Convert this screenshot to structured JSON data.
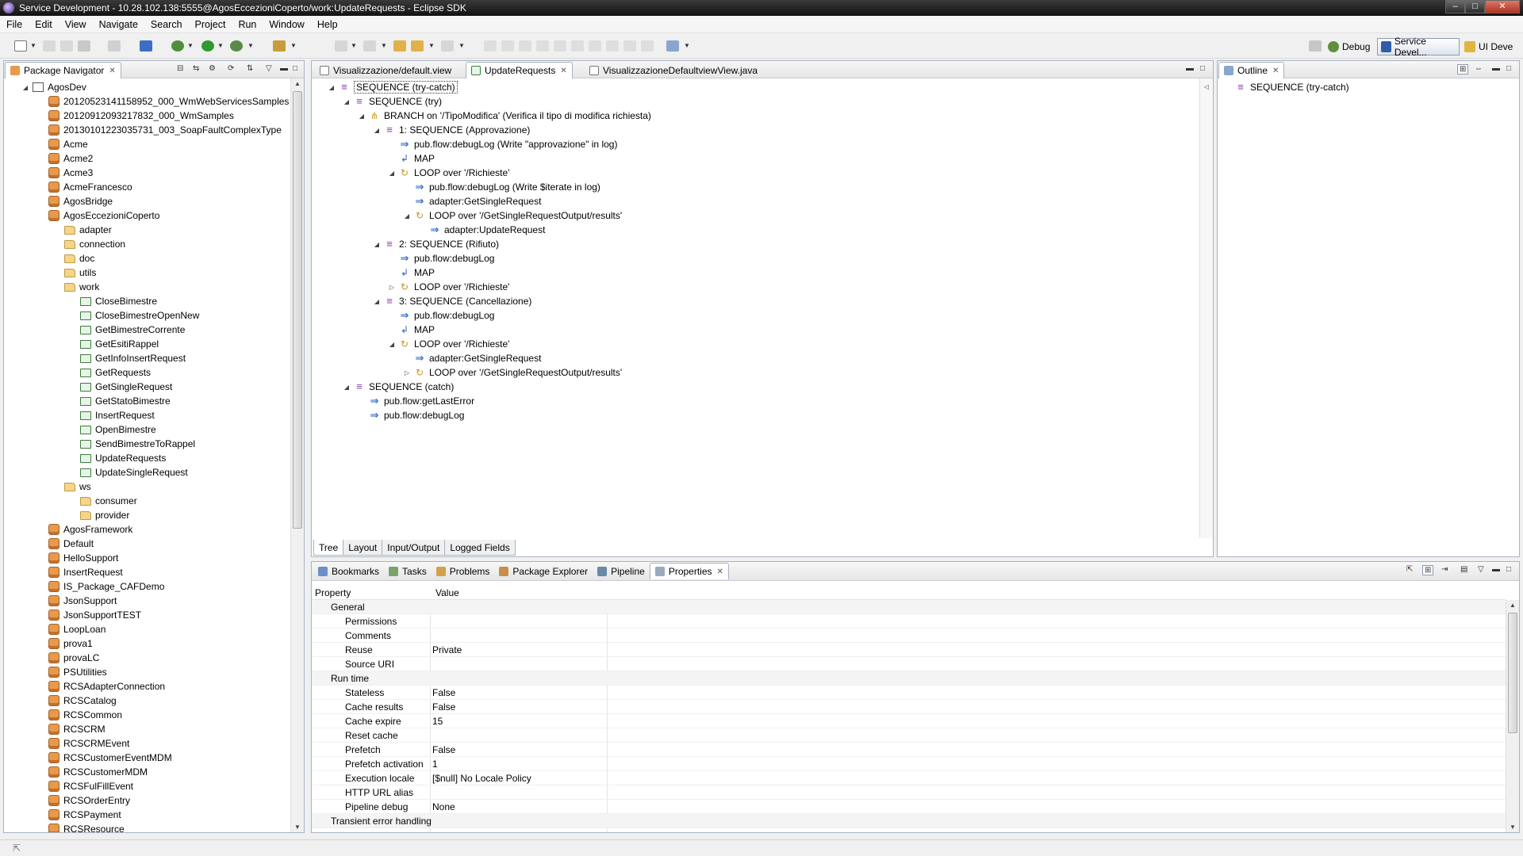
{
  "window": {
    "title": "Service Development - 10.28.102.138:5555@AgosEccezioniCoperto/work:UpdateRequests - Eclipse SDK",
    "controls": [
      "–",
      "□",
      "✕"
    ]
  },
  "menu": [
    "File",
    "Edit",
    "View",
    "Navigate",
    "Search",
    "Project",
    "Run",
    "Window",
    "Help"
  ],
  "perspectives": [
    {
      "label": "Debug",
      "active": false
    },
    {
      "label": "Service Devel...",
      "active": true
    },
    {
      "label": "UI Deve",
      "active": false
    }
  ],
  "navigator": {
    "tab": "Package Navigator",
    "items": [
      {
        "label": "AgosDev",
        "level": 0,
        "icon": "root",
        "twisty": "◢"
      },
      {
        "label": "20120523141158952_000_WmWebServicesSamples",
        "level": 1,
        "icon": "pkg"
      },
      {
        "label": "20120912093217832_000_WmSamples",
        "level": 1,
        "icon": "pkg"
      },
      {
        "label": "20130101223035731_003_SoapFaultComplexType",
        "level": 1,
        "icon": "pkg"
      },
      {
        "label": "Acme",
        "level": 1,
        "icon": "pkg"
      },
      {
        "label": "Acme2",
        "level": 1,
        "icon": "pkg"
      },
      {
        "label": "Acme3",
        "level": 1,
        "icon": "pkg"
      },
      {
        "label": "AcmeFrancesco",
        "level": 1,
        "icon": "pkg"
      },
      {
        "label": "AgosBridge",
        "level": 1,
        "icon": "pkg"
      },
      {
        "label": "AgosEccezioniCoperto",
        "level": 1,
        "icon": "pkg"
      },
      {
        "label": "adapter",
        "level": 2,
        "icon": "folder"
      },
      {
        "label": "connection",
        "level": 2,
        "icon": "folder"
      },
      {
        "label": "doc",
        "level": 2,
        "icon": "folder"
      },
      {
        "label": "utils",
        "level": 2,
        "icon": "folder"
      },
      {
        "label": "work",
        "level": 2,
        "icon": "folder"
      },
      {
        "label": "CloseBimestre",
        "level": 3,
        "icon": "svc"
      },
      {
        "label": "CloseBimestreOpenNew",
        "level": 3,
        "icon": "svc"
      },
      {
        "label": "GetBimestreCorrente",
        "level": 3,
        "icon": "svc"
      },
      {
        "label": "GetEsitiRappel",
        "level": 3,
        "icon": "svc"
      },
      {
        "label": "GetInfoInsertRequest",
        "level": 3,
        "icon": "svc"
      },
      {
        "label": "GetRequests",
        "level": 3,
        "icon": "svc"
      },
      {
        "label": "GetSingleRequest",
        "level": 3,
        "icon": "svc"
      },
      {
        "label": "GetStatoBimestre",
        "level": 3,
        "icon": "svc"
      },
      {
        "label": "InsertRequest",
        "level": 3,
        "icon": "svc"
      },
      {
        "label": "OpenBimestre",
        "level": 3,
        "icon": "svc"
      },
      {
        "label": "SendBimestreToRappel",
        "level": 3,
        "icon": "svc"
      },
      {
        "label": "UpdateRequests",
        "level": 3,
        "icon": "svc"
      },
      {
        "label": "UpdateSingleRequest",
        "level": 3,
        "icon": "svc"
      },
      {
        "label": "ws",
        "level": 2,
        "icon": "folder"
      },
      {
        "label": "consumer",
        "level": 3,
        "icon": "folder"
      },
      {
        "label": "provider",
        "level": 3,
        "icon": "folder"
      },
      {
        "label": "AgosFramework",
        "level": 1,
        "icon": "pkg"
      },
      {
        "label": "Default",
        "level": 1,
        "icon": "pkg"
      },
      {
        "label": "HelloSupport",
        "level": 1,
        "icon": "pkg"
      },
      {
        "label": "InsertRequest",
        "level": 1,
        "icon": "pkg"
      },
      {
        "label": "IS_Package_CAFDemo",
        "level": 1,
        "icon": "pkg"
      },
      {
        "label": "JsonSupport",
        "level": 1,
        "icon": "pkg"
      },
      {
        "label": "JsonSupportTEST",
        "level": 1,
        "icon": "pkg"
      },
      {
        "label": "LoopLoan",
        "level": 1,
        "icon": "pkg"
      },
      {
        "label": "prova1",
        "level": 1,
        "icon": "pkg"
      },
      {
        "label": "provaLC",
        "level": 1,
        "icon": "pkg"
      },
      {
        "label": "PSUtilities",
        "level": 1,
        "icon": "pkg"
      },
      {
        "label": "RCSAdapterConnection",
        "level": 1,
        "icon": "pkg"
      },
      {
        "label": "RCSCatalog",
        "level": 1,
        "icon": "pkg"
      },
      {
        "label": "RCSCommon",
        "level": 1,
        "icon": "pkg"
      },
      {
        "label": "RCSCRM",
        "level": 1,
        "icon": "pkg"
      },
      {
        "label": "RCSCRMEvent",
        "level": 1,
        "icon": "pkg"
      },
      {
        "label": "RCSCustomerEventMDM",
        "level": 1,
        "icon": "pkg"
      },
      {
        "label": "RCSCustomerMDM",
        "level": 1,
        "icon": "pkg"
      },
      {
        "label": "RCSFulFillEvent",
        "level": 1,
        "icon": "pkg"
      },
      {
        "label": "RCSOrderEntry",
        "level": 1,
        "icon": "pkg"
      },
      {
        "label": "RCSPayment",
        "level": 1,
        "icon": "pkg"
      },
      {
        "label": "RCSResource",
        "level": 1,
        "icon": "pkg"
      }
    ]
  },
  "editor": {
    "tabs": [
      {
        "label": "Visualizzazione/default.view",
        "active": false
      },
      {
        "label": "UpdateRequests",
        "active": true
      },
      {
        "label": "VisualizzazioneDefaultviewView.java",
        "active": false
      }
    ],
    "steps": [
      {
        "label": "SEQUENCE (try-catch)",
        "level": 0,
        "icon": "seq",
        "twisty": "◢",
        "selected": true
      },
      {
        "label": "SEQUENCE (try)",
        "level": 1,
        "icon": "seq",
        "twisty": "◢"
      },
      {
        "label": "BRANCH on '/TipoModifica' (Verifica il tipo di modifica richiesta)",
        "level": 2,
        "icon": "branch",
        "twisty": "◢"
      },
      {
        "label": "1: SEQUENCE (Approvazione)",
        "level": 3,
        "icon": "seq",
        "twisty": "◢"
      },
      {
        "label": "pub.flow:debugLog (Write \"approvazione\" in log)",
        "level": 4,
        "icon": "invoke"
      },
      {
        "label": "MAP",
        "level": 4,
        "icon": "map"
      },
      {
        "label": "LOOP over '/Richieste'",
        "level": 4,
        "icon": "loop",
        "twisty": "◢"
      },
      {
        "label": "pub.flow:debugLog (Write $iterate in log)",
        "level": 5,
        "icon": "invoke"
      },
      {
        "label": "adapter:GetSingleRequest",
        "level": 5,
        "icon": "invoke"
      },
      {
        "label": "LOOP over '/GetSingleRequestOutput/results'",
        "level": 5,
        "icon": "loop",
        "twisty": "◢"
      },
      {
        "label": "adapter:UpdateRequest",
        "level": 6,
        "icon": "invoke"
      },
      {
        "label": "2: SEQUENCE (Rifiuto)",
        "level": 3,
        "icon": "seq",
        "twisty": "◢"
      },
      {
        "label": "pub.flow:debugLog",
        "level": 4,
        "icon": "invoke"
      },
      {
        "label": "MAP",
        "level": 4,
        "icon": "map"
      },
      {
        "label": "LOOP over '/Richieste'",
        "level": 4,
        "icon": "loop",
        "twisty": "▷"
      },
      {
        "label": "3: SEQUENCE (Cancellazione)",
        "level": 3,
        "icon": "seq",
        "twisty": "◢"
      },
      {
        "label": "pub.flow:debugLog",
        "level": 4,
        "icon": "invoke"
      },
      {
        "label": "MAP",
        "level": 4,
        "icon": "map"
      },
      {
        "label": "LOOP over '/Richieste'",
        "level": 4,
        "icon": "loop",
        "twisty": "◢"
      },
      {
        "label": "adapter:GetSingleRequest",
        "level": 5,
        "icon": "invoke"
      },
      {
        "label": "LOOP over '/GetSingleRequestOutput/results'",
        "level": 5,
        "icon": "loop",
        "twisty": "▷"
      },
      {
        "label": "SEQUENCE (catch)",
        "level": 1,
        "icon": "seq",
        "twisty": "◢"
      },
      {
        "label": "pub.flow:getLastError",
        "level": 2,
        "icon": "invoke"
      },
      {
        "label": "pub.flow:debugLog",
        "level": 2,
        "icon": "invoke"
      }
    ],
    "bottom_tabs": [
      {
        "label": "Tree",
        "active": true
      },
      {
        "label": "Layout",
        "active": false
      },
      {
        "label": "Input/Output",
        "active": false
      },
      {
        "label": "Logged Fields",
        "active": false
      }
    ]
  },
  "outline": {
    "tab": "Outline",
    "items": [
      {
        "label": "SEQUENCE (try-catch)"
      }
    ]
  },
  "bottom_panel": {
    "tabs": [
      {
        "label": "Bookmarks",
        "active": false
      },
      {
        "label": "Tasks",
        "active": false
      },
      {
        "label": "Problems",
        "active": false
      },
      {
        "label": "Package Explorer",
        "active": false
      },
      {
        "label": "Pipeline",
        "active": false
      },
      {
        "label": "Properties",
        "active": true
      }
    ],
    "columns": [
      "Property",
      "Value"
    ],
    "rows": [
      {
        "key": "General",
        "value": "",
        "category": true
      },
      {
        "key": "Permissions",
        "value": ""
      },
      {
        "key": "Comments",
        "value": ""
      },
      {
        "key": "Reuse",
        "value": "Private"
      },
      {
        "key": "Source URI",
        "value": ""
      },
      {
        "key": "Run time",
        "value": "",
        "category": true
      },
      {
        "key": "Stateless",
        "value": "False"
      },
      {
        "key": "Cache results",
        "value": "False"
      },
      {
        "key": "Cache expire",
        "value": "15"
      },
      {
        "key": "Reset cache",
        "value": ""
      },
      {
        "key": "Prefetch",
        "value": "False"
      },
      {
        "key": "Prefetch activation",
        "value": "1"
      },
      {
        "key": "Execution locale",
        "value": "[$null] No Locale Policy"
      },
      {
        "key": "HTTP URL alias",
        "value": ""
      },
      {
        "key": "Pipeline debug",
        "value": "None"
      },
      {
        "key": "Transient error handling",
        "value": "",
        "category": true
      }
    ]
  }
}
